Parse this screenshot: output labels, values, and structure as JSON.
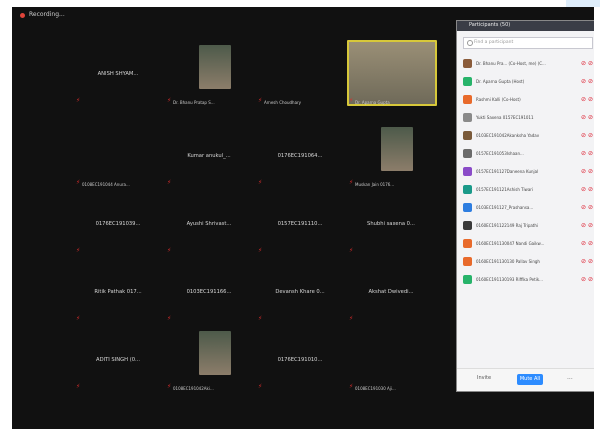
{
  "recording": {
    "label": "Recording..."
  },
  "grid": {
    "rows": [
      [
        {
          "title": "ANISH SHYAM...",
          "label": "",
          "avatar": null
        },
        {
          "title": "",
          "label": "Dr. Bhanu Pratap S...",
          "avatar": "photo"
        },
        {
          "title": "",
          "label": "Arnesh Choudhary",
          "avatar": null
        },
        {
          "title": "",
          "label": "Dr. Aparna Gupta",
          "avatar": "photo",
          "active_speaker": true
        }
      ],
      [
        {
          "title": "",
          "label": "0108EC191044 Anura...",
          "avatar": null
        },
        {
          "title": "Kumar anukul_...",
          "label": "",
          "avatar": null
        },
        {
          "title": "0176EC191064...",
          "label": "",
          "avatar": null
        },
        {
          "title": "",
          "label": "Muskan Jain 0176...",
          "avatar": "photo"
        }
      ],
      [
        {
          "title": "0176EC191039...",
          "label": "",
          "avatar": null
        },
        {
          "title": "Ayushi Shrivast...",
          "label": "",
          "avatar": null
        },
        {
          "title": "0157EC191110...",
          "label": "",
          "avatar": null
        },
        {
          "title": "Shubhi saxena 0...",
          "label": "",
          "avatar": null
        }
      ],
      [
        {
          "title": "Ritik Pathak 017...",
          "label": "",
          "avatar": null
        },
        {
          "title": "0103EC191166...",
          "label": "",
          "avatar": null
        },
        {
          "title": "Devansh Khare 0...",
          "label": "",
          "avatar": null
        },
        {
          "title": "Akshat Dwivedi...",
          "label": "",
          "avatar": null
        }
      ],
      [
        {
          "title": "ADITI SINGH (0...",
          "label": "",
          "avatar": null
        },
        {
          "title": "",
          "label": "0108EC191042Aki...",
          "avatar": "photo"
        },
        {
          "title": "0176EC191010...",
          "label": "",
          "avatar": null
        },
        {
          "title": "",
          "label": "0108EC191030 Aji...",
          "avatar": null
        }
      ]
    ]
  },
  "participants_panel": {
    "title": "Participants (50)",
    "search_placeholder": "Find a participant",
    "items": [
      {
        "name": "Dr. Bhanu Pra... (Co-Host, me) (C...",
        "avatar_color": "#8a5b3a"
      },
      {
        "name": "Dr. Aparna Gupta (Host)",
        "avatar_color": "#27b36a"
      },
      {
        "name": "Rashmi Kalli (Co-Host)",
        "avatar_color": "#e86a2b"
      },
      {
        "name": "Yukti Saxena 0157EC191011",
        "avatar_color": "#8a8a8a"
      },
      {
        "name": "0103EC191042Akanksha Yadav",
        "avatar_color": "#7a5a3a"
      },
      {
        "name": "0157EC191053Ishaan...",
        "avatar_color": "#6b6b6b"
      },
      {
        "name": "0157EC191127Daneena Kunjal",
        "avatar_color": "#8a4bc8"
      },
      {
        "name": "0157EC191121Ashish Tiwari",
        "avatar_color": "#1a9a8a"
      },
      {
        "name": "0103EC191127_Prashansa...",
        "avatar_color": "#2d7de0"
      },
      {
        "name": "0160EC191122149 Raj Tripathi",
        "avatar_color": "#3a3a3a"
      },
      {
        "name": "0160EC191130047 Nandi Gaikw...",
        "avatar_color": "#e86a2b"
      },
      {
        "name": "0160EC191130130 Pallav Singh",
        "avatar_color": "#e86a2b"
      },
      {
        "name": "0160EC191130193 Riffika Petik...",
        "avatar_color": "#27b36a"
      }
    ],
    "footer": {
      "invite": "Invite",
      "mute_all": "Mute All",
      "more": "..."
    }
  }
}
